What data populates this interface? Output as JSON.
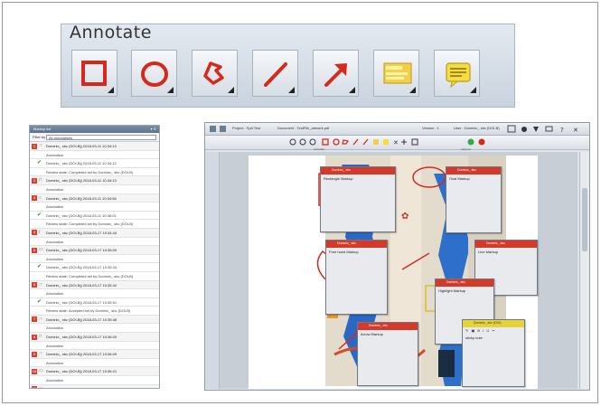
{
  "annotate": {
    "title": "Annotate",
    "tools": [
      {
        "name": "rectangle-tool-icon"
      },
      {
        "name": "ellipse-tool-icon"
      },
      {
        "name": "polygon-tool-icon"
      },
      {
        "name": "line-tool-icon"
      },
      {
        "name": "arrow-tool-icon"
      },
      {
        "name": "highlight-tool-icon"
      },
      {
        "name": "note-tool-icon"
      }
    ]
  },
  "colors": {
    "accent_red": "#d43a2a",
    "toolbar_bg": "#cfd8e2",
    "note_yellow": "#e6d23a",
    "check_green": "#2e8b2e"
  },
  "list_panel": {
    "title": "Markup list",
    "filter_label": "Filter by",
    "filter_value": "All annotations",
    "items": [
      {
        "type": "main",
        "num": "1",
        "kind": "☞",
        "text": "Dominic_ sbc (DOI-Bj) 2018-03-11 10:34:13"
      },
      {
        "type": "sub",
        "text": "Annotation"
      },
      {
        "type": "check",
        "text": "Dominic_ sbc (DOI-Bj) 2018-03-11 10:34:12"
      },
      {
        "type": "sub",
        "text": "Review state: Completed set by Dominic_ sbc (DOI-B)"
      },
      {
        "type": "main",
        "num": "2",
        "kind": "□",
        "text": "Dominic_ sbc (DOI-Bj) 2018-03-11 10:34:13"
      },
      {
        "type": "sub",
        "text": "Annotation"
      },
      {
        "type": "main",
        "num": "3",
        "kind": "○",
        "text": "Dominic_ sbc (DOI-Bj) 2018-03-11 10:34:56"
      },
      {
        "type": "sub",
        "text": "Annotation"
      },
      {
        "type": "check",
        "text": "Dominic_ sbc (DOI-Bj) 2018-03-11 10:36:01"
      },
      {
        "type": "sub",
        "text": "Review state: Completed set by Dominic_ sbc (DOI-B)"
      },
      {
        "type": "main",
        "num": "4",
        "kind": "/",
        "text": "Dominic_ sbc (DOI-Bj) 2018-03-17 10:34:44"
      },
      {
        "type": "sub",
        "text": "Annotation"
      },
      {
        "type": "main",
        "num": "5",
        "kind": "▭",
        "text": "Dominic_ sbc (DOI-Bj) 2018-03-17 10:35:09"
      },
      {
        "type": "sub",
        "text": "Annotation"
      },
      {
        "type": "check",
        "text": "Dominic_ sbc (DOI-Bj) 2018-03-17 10:35:34"
      },
      {
        "type": "sub",
        "text": "Review state: Completed set by Dominic_ sbc (DOI-B)"
      },
      {
        "type": "main",
        "num": "6",
        "kind": "☞",
        "text": "Dominic_ sbc (DOI-Bj) 2018-03-17 10:35:42"
      },
      {
        "type": "sub",
        "text": "Annotation"
      },
      {
        "type": "check",
        "text": "Dominic_ sbc (DOI-Bj) 2018-03-17 10:35:51"
      },
      {
        "type": "sub",
        "text": "Review state: Accepted set by Dominic_ sbc (DOI-B)"
      },
      {
        "type": "main",
        "num": "7",
        "kind": "☞",
        "text": "Dominic_ sbc (DOI-Bj) 2018-03-17 10:35:48"
      },
      {
        "type": "sub",
        "text": "Annotation"
      },
      {
        "type": "main",
        "num": "8",
        "kind": "□",
        "text": "Dominic_ sbc (DOI-Bj) 2018-03-17 10:36:00"
      },
      {
        "type": "sub",
        "text": "Annotation"
      },
      {
        "type": "main",
        "num": "9",
        "kind": "☞",
        "text": "Dominic_ sbc (DOI-Bj) 2018-03-17 10:36:09"
      },
      {
        "type": "sub",
        "text": "Annotation"
      },
      {
        "type": "main",
        "num": "10",
        "kind": "▭",
        "text": "Dominic_ sbc (DOI-Bj) 2018-03-17 10:36:21"
      },
      {
        "type": "sub",
        "text": "Annotation"
      },
      {
        "type": "main",
        "num": "11",
        "kind": "☞",
        "text": "Dominic_ sbc (DOI-Bj) 2018-03-17 10:36:34"
      },
      {
        "type": "sub",
        "text": "Annotation"
      }
    ]
  },
  "viewer": {
    "project": "Project : Spit Test",
    "document": "Document : TestFile_artwork.pdf",
    "version": "Version : 1",
    "user": "User : Dominic_ sbc (DOI-B)",
    "section_annotate": "Annotate",
    "section_approve": "Approve",
    "notes": [
      {
        "header": "Dominic_ sbc",
        "body": "Rectangle Markup"
      },
      {
        "header": "Dominic_ sbc",
        "body": "Oval Markup"
      },
      {
        "header": "Dominic_ sbc",
        "body": "Free hand Markup"
      },
      {
        "header": "Dominic_ sbc",
        "body": "Line Markup"
      },
      {
        "header": "Dominic_ sbc",
        "body": "Highlight Markup"
      },
      {
        "header": "Dominic_ sbc",
        "body": "Arrow Markup"
      },
      {
        "header": "Dominic_ sbc (DOI)",
        "body": "sticky note"
      }
    ]
  }
}
